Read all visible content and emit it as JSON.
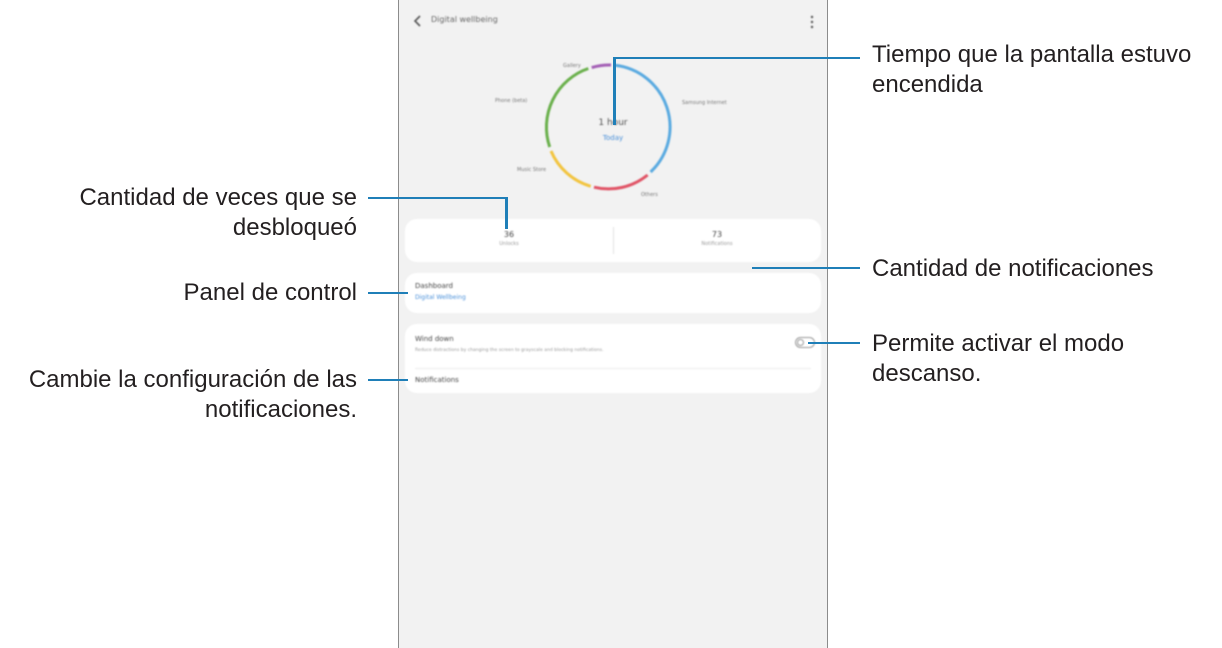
{
  "screen": {
    "title": "Digital wellbeing",
    "back_icon": "back-arrow-icon",
    "menu_icon": "more-options-icon",
    "screen_time": "1 hour",
    "screen_time_link": "Today",
    "apps": [
      {
        "name": "Gallery",
        "color": "#a35fb5"
      },
      {
        "name": "Samsung Internet",
        "color": "#5aaae0"
      },
      {
        "name": "Others",
        "color": "#e05466"
      },
      {
        "name": "Music Store",
        "color": "#f2c440"
      },
      {
        "name": "Phone (beta)",
        "color": "#6ab04c"
      }
    ],
    "unlocks": {
      "value": "36",
      "label": "Unlocks"
    },
    "notifications": {
      "value": "73",
      "label": "Notifications"
    },
    "dashboard": {
      "title": "Dashboard",
      "subtitle": "Digital Wellbeing"
    },
    "wind_down": {
      "title": "Wind down",
      "description": "Reduce distractions by changing the screen to grayscale and blocking notifications.",
      "enabled": false
    },
    "notifications_item": "Notifications"
  },
  "callouts": {
    "screen_time": "Tiempo que la pantalla estuvo encendida",
    "unlocks": "Cantidad de veces que se desbloqueó",
    "notifications": "Cantidad de notificaciones",
    "dashboard": "Panel de control",
    "wind_down": "Permite activar el modo descanso.",
    "notification_settings": "Cambie la configuración de las notificaciones.",
    "line_color": "#1f7fb8"
  }
}
